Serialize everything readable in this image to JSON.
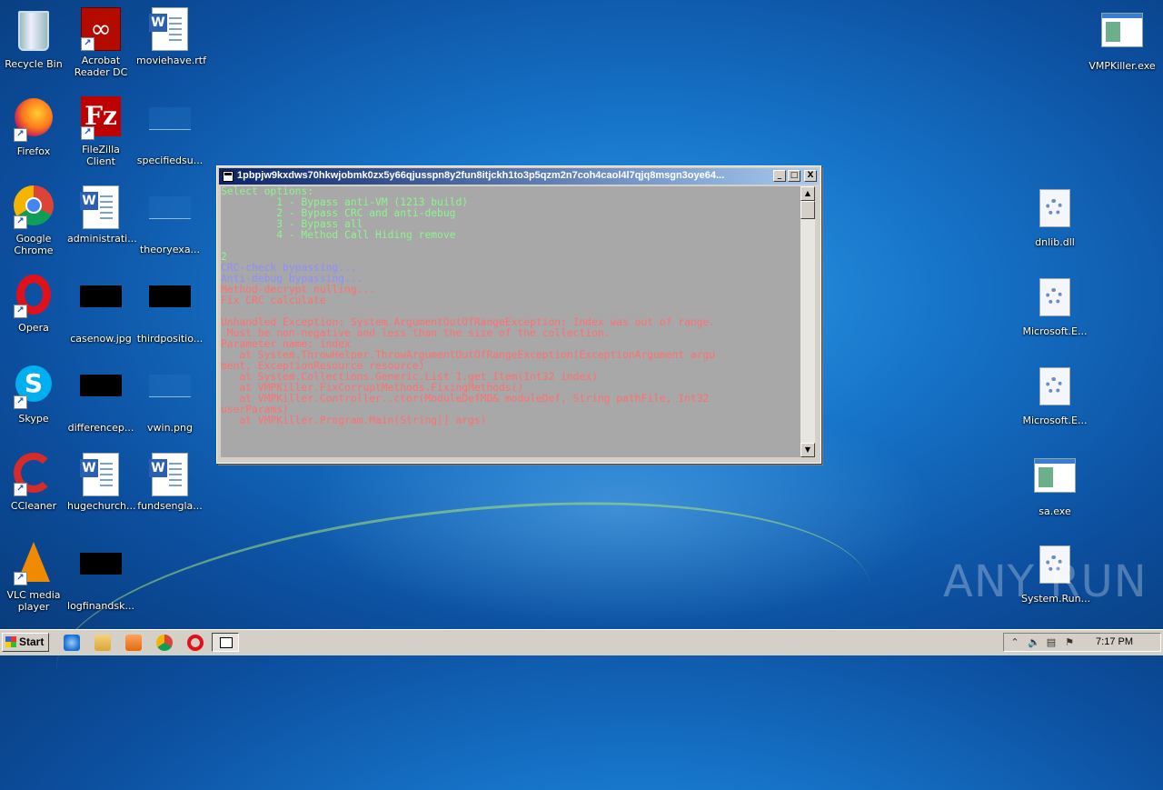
{
  "desktop": {
    "left_icons": [
      {
        "label": "Recycle Bin"
      },
      {
        "label": "Acrobat Reader DC"
      },
      {
        "label": "moviehave.rtf"
      },
      {
        "label": "Firefox"
      },
      {
        "label": "FileZilla Client"
      },
      {
        "label": "specifiedsu..."
      },
      {
        "label": "Google Chrome"
      },
      {
        "label": "administrati..."
      },
      {
        "label": "theoryexa..."
      },
      {
        "label": "Opera"
      },
      {
        "label": "casenow.jpg"
      },
      {
        "label": "thirdpositio..."
      },
      {
        "label": "Skype"
      },
      {
        "label": "differencep..."
      },
      {
        "label": "vwin.png"
      },
      {
        "label": "CCleaner"
      },
      {
        "label": "hugechurch..."
      },
      {
        "label": "fundsengla..."
      },
      {
        "label": "VLC media player"
      },
      {
        "label": "logfinandsk..."
      }
    ],
    "right_icons": [
      {
        "label": "VMPKiller.exe"
      },
      {
        "label": "dnlib.dll"
      },
      {
        "label": "Microsoft.E..."
      },
      {
        "label": "Microsoft.E..."
      },
      {
        "label": "sa.exe"
      },
      {
        "label": "System.Run..."
      }
    ],
    "watermark": "ANY RUN"
  },
  "console_window": {
    "title": "1pbpjw9kxdws70hkwjobmk0zx5y66qjusspn8y2fun8itjckh1to3p5qzm2n7coh4caol4l7qjq8msgn3oye64...",
    "minimize_label": "_",
    "maximize_label": "□",
    "close_label": "X",
    "lines": [
      {
        "text": "Select options:",
        "color": "green"
      },
      {
        "text": "         1 - Bypass anti-VM (1213 build)",
        "color": "green"
      },
      {
        "text": "         2 - Bypass CRC and anti-debug",
        "color": "green"
      },
      {
        "text": "         3 - Bypass all",
        "color": "green"
      },
      {
        "text": "         4 - Method Call Hiding remove",
        "color": "green"
      },
      {
        "text": "",
        "color": "green"
      },
      {
        "text": "2",
        "color": "green"
      },
      {
        "text": "CRC-check bypassing...",
        "color": "blue"
      },
      {
        "text": "Anti-debug bypassing...",
        "color": "blue"
      },
      {
        "text": "Method-decrypt nulling...",
        "color": "red"
      },
      {
        "text": "Fix CRC calculate",
        "color": "red"
      },
      {
        "text": "",
        "color": "red"
      },
      {
        "text": "Unhandled Exception: System.ArgumentOutOfRangeException: Index was out of range.",
        "color": "red"
      },
      {
        "text": " Must be non-negative and less than the size of the collection.",
        "color": "red"
      },
      {
        "text": "Parameter name: index",
        "color": "red"
      },
      {
        "text": "   at System.ThrowHelper.ThrowArgumentOutOfRangeException(ExceptionArgument argu",
        "color": "red"
      },
      {
        "text": "ment, ExceptionResource resource)",
        "color": "red"
      },
      {
        "text": "   at System.Collections.Generic.List`1.get_Item(Int32 index)",
        "color": "red"
      },
      {
        "text": "   at VMPKiller.FixCorruptMethods.FixingMethods()",
        "color": "red"
      },
      {
        "text": "   at VMPKiller.Controller..ctor(ModuleDefMD& moduleDef, String pathFile, Int32",
        "color": "red"
      },
      {
        "text": "userParams)",
        "color": "red"
      },
      {
        "text": "   at VMPKiller.Program.Main(String[] args)",
        "color": "red"
      }
    ]
  },
  "taskbar": {
    "start_label": "Start",
    "clock": "7:17 PM"
  },
  "colors": {
    "console_bg": "#a8a8a8",
    "green": "#8cf58c",
    "blue": "#8e8eff",
    "red": "#ff7070"
  }
}
